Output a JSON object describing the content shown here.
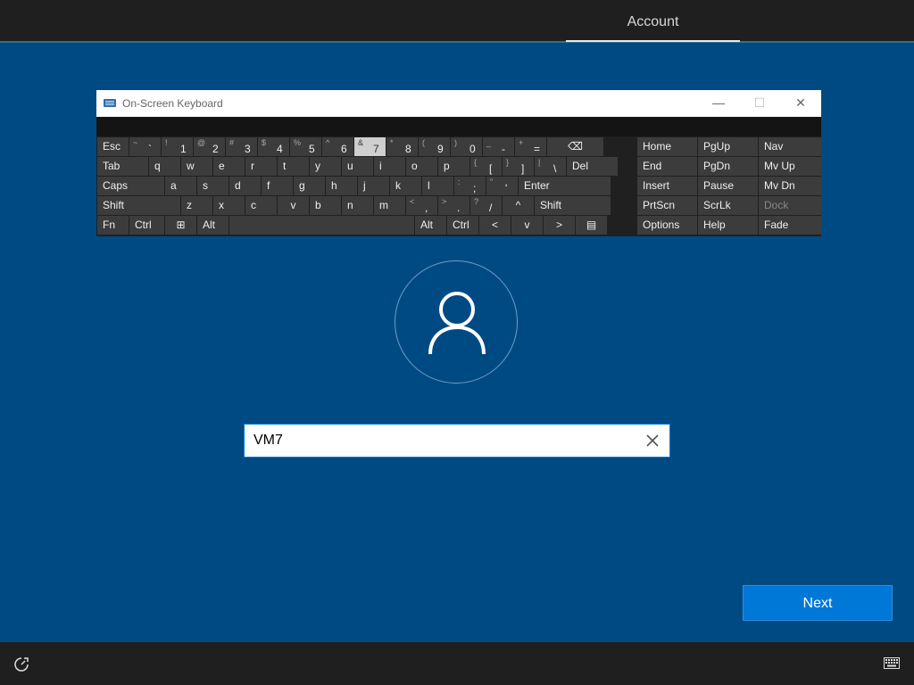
{
  "header": {
    "tab_label": "Account"
  },
  "osk": {
    "title": "On-Screen Keyboard",
    "minimize": "—",
    "maximize": "☐",
    "close": "✕",
    "rows": [
      [
        {
          "label": "Esc"
        },
        {
          "shift": "~",
          "main": "`"
        },
        {
          "shift": "!",
          "main": "1"
        },
        {
          "shift": "@",
          "main": "2"
        },
        {
          "shift": "#",
          "main": "3"
        },
        {
          "shift": "$",
          "main": "4"
        },
        {
          "shift": "%",
          "main": "5"
        },
        {
          "shift": "^",
          "main": "6"
        },
        {
          "shift": "&",
          "main": "7"
        },
        {
          "shift": "*",
          "main": "8"
        },
        {
          "shift": "(",
          "main": "9"
        },
        {
          "shift": ")",
          "main": "0"
        },
        {
          "shift": "_",
          "main": "-"
        },
        {
          "shift": "+",
          "main": "="
        },
        {
          "label": "⌫"
        }
      ],
      [
        {
          "label": "Tab"
        },
        {
          "label": "q"
        },
        {
          "label": "w"
        },
        {
          "label": "e"
        },
        {
          "label": "r"
        },
        {
          "label": "t"
        },
        {
          "label": "y"
        },
        {
          "label": "u"
        },
        {
          "label": "i"
        },
        {
          "label": "o"
        },
        {
          "label": "p"
        },
        {
          "shift": "{",
          "main": "["
        },
        {
          "shift": "}",
          "main": "]"
        },
        {
          "shift": "|",
          "main": "\\"
        },
        {
          "label": "Del"
        }
      ],
      [
        {
          "label": "Caps"
        },
        {
          "label": "a"
        },
        {
          "label": "s"
        },
        {
          "label": "d"
        },
        {
          "label": "f"
        },
        {
          "label": "g"
        },
        {
          "label": "h"
        },
        {
          "label": "j"
        },
        {
          "label": "k"
        },
        {
          "label": "l"
        },
        {
          "shift": ":",
          "main": ";"
        },
        {
          "shift": "\"",
          "main": "'"
        },
        {
          "label": "Enter"
        }
      ],
      [
        {
          "label": "Shift"
        },
        {
          "label": "z"
        },
        {
          "label": "x"
        },
        {
          "label": "c"
        },
        {
          "label": "v"
        },
        {
          "label": "b"
        },
        {
          "label": "n"
        },
        {
          "label": "m"
        },
        {
          "shift": "<",
          "main": ","
        },
        {
          "shift": ">",
          "main": "."
        },
        {
          "shift": "?",
          "main": "/"
        },
        {
          "label": "^"
        },
        {
          "label": "Shift"
        }
      ],
      [
        {
          "label": "Fn"
        },
        {
          "label": "Ctrl"
        },
        {
          "label": "⊞"
        },
        {
          "label": "Alt"
        },
        {
          "label": ""
        },
        {
          "label": "Alt"
        },
        {
          "label": "Ctrl"
        },
        {
          "label": "<"
        },
        {
          "label": "v"
        },
        {
          "label": ">"
        },
        {
          "label": "▤"
        }
      ]
    ],
    "nav": [
      [
        "Home",
        "PgUp",
        "Nav"
      ],
      [
        "End",
        "PgDn",
        "Mv Up"
      ],
      [
        "Insert",
        "Pause",
        "Mv Dn"
      ],
      [
        "PrtScn",
        "ScrLk",
        "Dock"
      ],
      [
        "Options",
        "Help",
        "Fade"
      ]
    ],
    "pressed_key": "7"
  },
  "username": {
    "value": "VM7"
  },
  "next_label": "Next",
  "colors": {
    "background": "#004a84",
    "accent": "#0078d7",
    "bar": "#1f1f1f"
  },
  "icons": {
    "ease_of_access": "ease-of-access-icon",
    "keyboard": "keyboard-icon",
    "user": "user-icon",
    "clear": "close-icon"
  }
}
